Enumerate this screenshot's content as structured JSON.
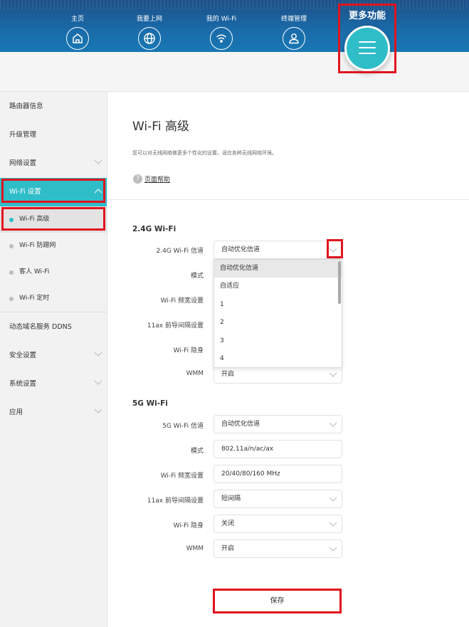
{
  "nav": {
    "items": [
      {
        "label": "主页",
        "icon": "home-icon"
      },
      {
        "label": "我要上网",
        "icon": "globe-icon"
      },
      {
        "label": "我的 Wi-Fi",
        "icon": "wifi-icon"
      },
      {
        "label": "终端管理",
        "icon": "user-icon"
      }
    ],
    "more_label": "更多功能"
  },
  "sidebar": {
    "items": [
      {
        "label": "路由器信息"
      },
      {
        "label": "升级管理"
      },
      {
        "label": "网络设置"
      },
      {
        "label": "Wi-Fi 设置"
      },
      {
        "label": "动态域名服务 DDNS"
      },
      {
        "label": "安全设置"
      },
      {
        "label": "系统设置"
      },
      {
        "label": "应用"
      }
    ],
    "subitems": [
      {
        "label": "Wi-Fi 高级"
      },
      {
        "label": "Wi-Fi 防蹭网"
      },
      {
        "label": "客人 Wi-Fi"
      },
      {
        "label": "Wi-Fi 定时"
      }
    ]
  },
  "content": {
    "title": "Wi-Fi 高级",
    "description": "您可以对无线网络做更多个性化的设置，适应各种无线网络环境。",
    "help_link": "页面帮助",
    "help_glyph": "?"
  },
  "wifi24": {
    "section_title": "2.4G Wi-Fi",
    "fields": [
      {
        "label": "2.4G Wi-Fi 信道",
        "value": "自动优化信道"
      },
      {
        "label": "模式",
        "value": ""
      },
      {
        "label": "Wi-Fi 频宽设置",
        "value": ""
      },
      {
        "label": "11ax 前导间隔设置",
        "value": ""
      },
      {
        "label": "Wi-Fi 隐身",
        "value": ""
      },
      {
        "label": "WMM",
        "value": "开启"
      }
    ],
    "channel_options": [
      "自动优化信道",
      "自适应",
      "1",
      "2",
      "3",
      "4"
    ]
  },
  "wifi5": {
    "section_title": "5G Wi-Fi",
    "fields": [
      {
        "label": "5G Wi-Fi 信道",
        "value": "自动优化信道"
      },
      {
        "label": "模式",
        "value": "802.11a/n/ac/ax"
      },
      {
        "label": "Wi-Fi 频宽设置",
        "value": "20/40/80/160 MHz"
      },
      {
        "label": "11ax 前导间隔设置",
        "value": "短间隔"
      },
      {
        "label": "Wi-Fi 隐身",
        "value": "关闭"
      },
      {
        "label": "WMM",
        "value": "开启"
      }
    ]
  },
  "actions": {
    "save_label": "保存"
  },
  "colors": {
    "accent": "#2fbdc8",
    "header": "#1a6aa8",
    "highlight": "#e0141e"
  }
}
